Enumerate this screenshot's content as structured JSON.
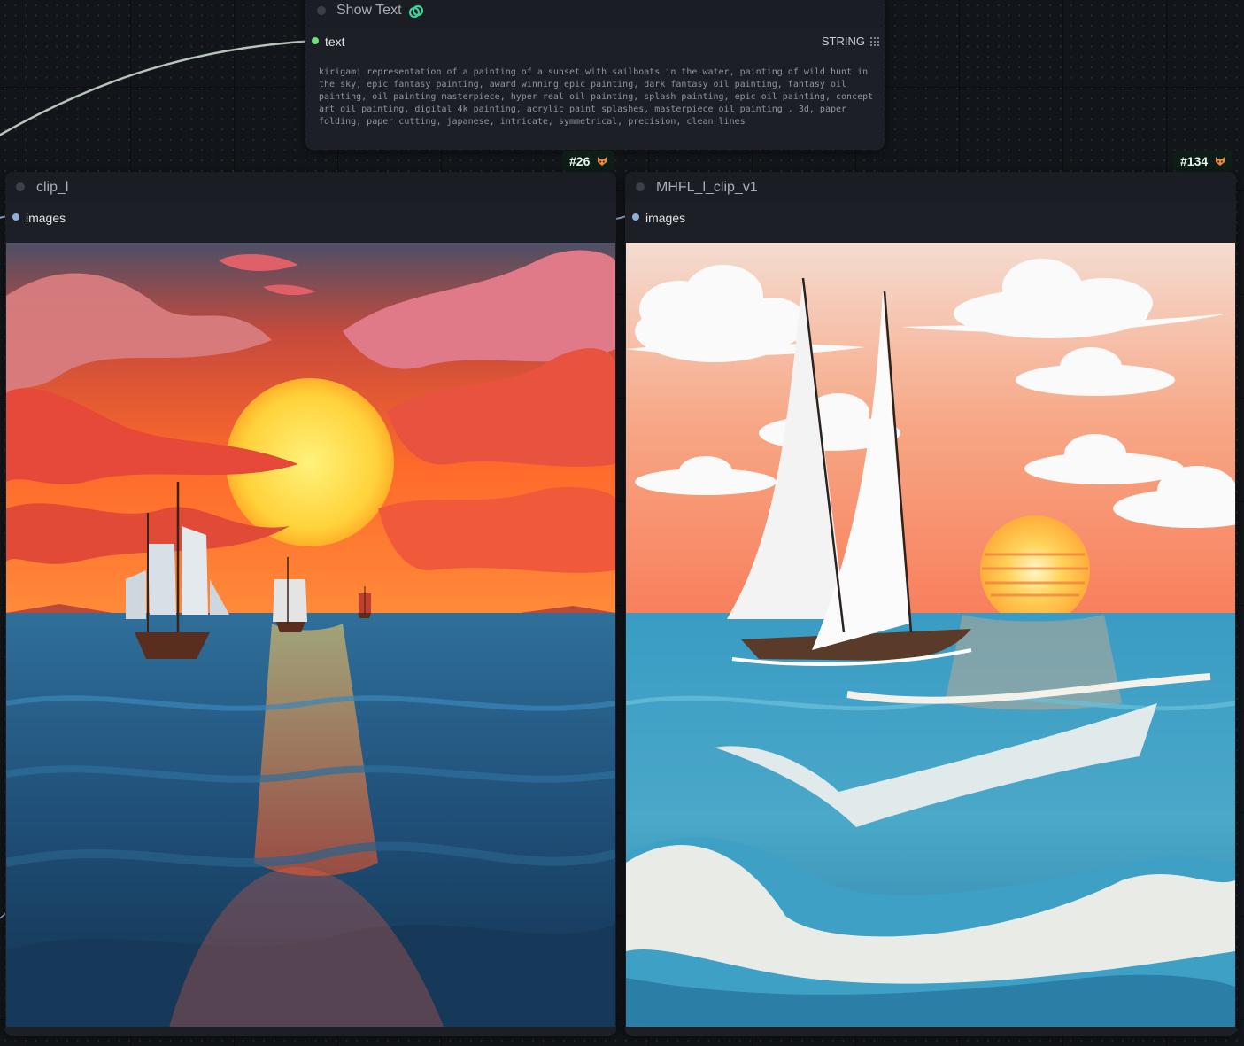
{
  "show_text_node": {
    "title": "Show Text",
    "icon": "link-chain-icon",
    "slot_label": "text",
    "slot_type": "STRING",
    "text_value": "kirigami representation of a painting of a sunset with sailboats in the water, painting of wild hunt in the sky, epic fantasy painting, award winning epic painting, dark fantasy oil painting, fantasy oil painting, oil painting masterpiece, hyper real oil painting, splash painting, epic oil painting, concept art oil painting, digital 4k painting, acrylic paint splashes, masterpiece oil painting . 3d, paper folding, paper cutting, japanese, intricate, symmetrical, precision, clean lines"
  },
  "preview_nodes": [
    {
      "id_badge": "#26",
      "badge_icon": "fox-icon",
      "title": "clip_l",
      "slot_label": "images",
      "image_description": "Papercraft sunset with three tall sailing ships on a blue sea under red clouds"
    },
    {
      "id_badge": "#134",
      "badge_icon": "fox-icon",
      "title": "MHFL_l_clip_v1",
      "slot_label": "images",
      "image_description": "Papercraft sailboat with two white sails on turquoise waves, white clouds and a yellow sun"
    }
  ],
  "colors": {
    "canvas_bg": "#121519",
    "node_bg": "#1c2026",
    "wire": "#b8c4bc",
    "string_slot": "#6fe07a",
    "image_slot": "#8fb0d8",
    "badge_bg": "#0f1d17"
  }
}
